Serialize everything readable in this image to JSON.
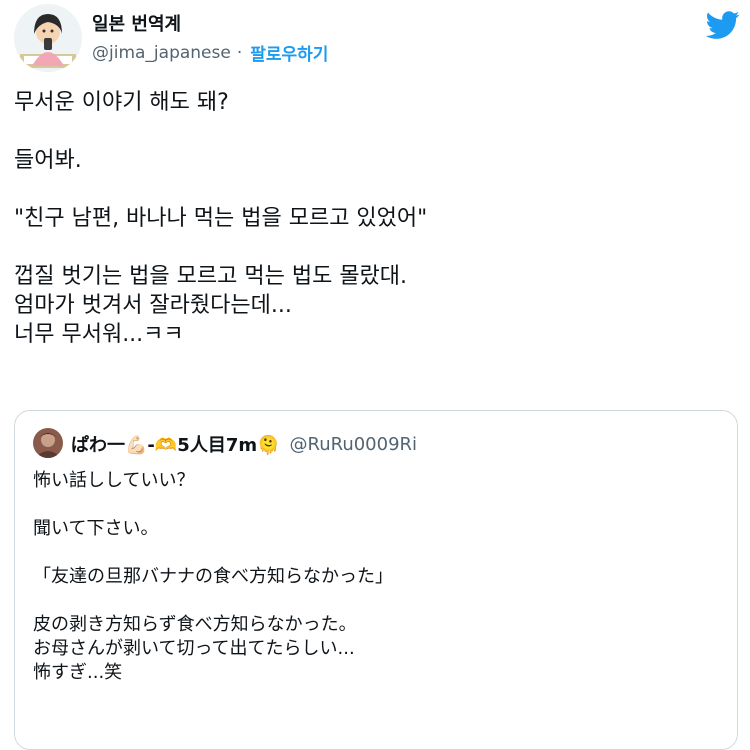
{
  "tweet": {
    "author_name": "일본 번역계",
    "author_handle": "@jima_japanese",
    "separator": "·",
    "follow_label": "팔로우하기",
    "lines": [
      "무서운 이야기 해도 돼?",
      "",
      "들어봐.",
      "",
      "\"친구 남편, 바나나 먹는 법을 모르고 있었어\"",
      "",
      "껍질 벗기는 법을 모르고 먹는 법도 몰랐대.",
      "엄마가 벗겨서 잘라줬다는데...",
      "너무 무서워...ㅋㅋ"
    ]
  },
  "quote": {
    "author_name": "ぱわ一💪🏻-🫶5人目7m🫠",
    "author_handle": "@RuRu0009Ri",
    "lines": [
      "怖い話ししていい？",
      "",
      "聞いて下さい。",
      "",
      "「友達の旦那バナナの食べ方知らなかった」",
      "",
      "皮の剥き方知らず食べ方知らなかった。",
      "お母さんが剥いて切って出てたらしい...",
      "怖すぎ...笑"
    ]
  },
  "icons": {
    "brand": "twitter-bird-icon",
    "avatar": "avatar-illustration",
    "quote_avatar": "quote-avatar-photo"
  },
  "colors": {
    "brand_blue": "#1d9bf0",
    "text_primary": "#0f1419",
    "text_secondary": "#536471",
    "border": "#cfd9de"
  }
}
